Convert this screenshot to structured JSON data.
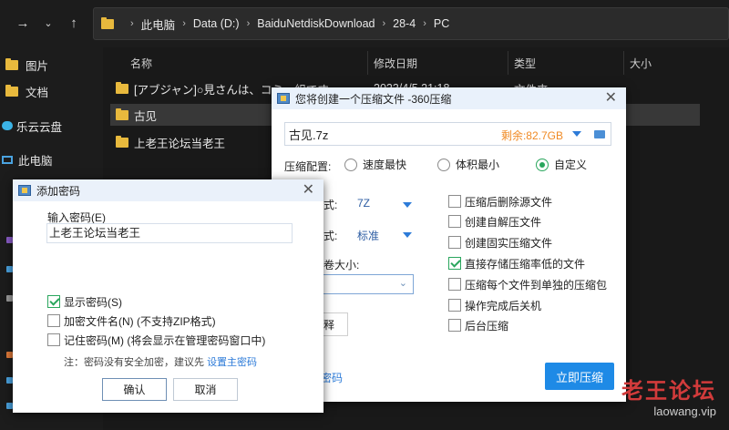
{
  "explorer": {
    "breadcrumb": [
      "此电脑",
      "Data (D:)",
      "BaiduNetdiskDownload",
      "28-4",
      "PC"
    ],
    "sidebar": [
      {
        "label": "图片",
        "icon": "folder-icon"
      },
      {
        "label": "文档",
        "icon": "folder-icon"
      },
      {
        "label": "乐云云盘",
        "icon": "cloud-icon"
      },
      {
        "label": "此电脑",
        "icon": "computer-icon"
      }
    ],
    "columns": [
      "名称",
      "修改日期",
      "类型",
      "大小"
    ],
    "rows": [
      {
        "name": "[アブジャン]○見さんは、コミ…組です。",
        "date": "2023/4/5 21:18",
        "type": "文件夹"
      },
      {
        "name": "古见",
        "date": "",
        "type": ""
      },
      {
        "name": "上老王论坛当老王",
        "date": "",
        "type": ""
      }
    ]
  },
  "zip_dialog": {
    "title": "您将创建一个压缩文件 -360压缩",
    "filename": "古见.7z",
    "free_space": "剩余:82.7GB",
    "config_label": "压缩配置:",
    "options": [
      "速度最快",
      "体积最小",
      "自定义"
    ],
    "selected_option": "自定义",
    "format_partial": "式:",
    "format_value": "7Z",
    "level_partial": "式:",
    "level_value": "标准",
    "volume_partial": "卷大小:",
    "left_button_partial": "释",
    "password_link_partial": "密码",
    "checkboxes": [
      {
        "label": "压缩后删除源文件",
        "checked": false
      },
      {
        "label": "创建自解压文件",
        "checked": false
      },
      {
        "label": "创建固实压缩文件",
        "checked": false
      },
      {
        "label": "直接存储压缩率低的文件",
        "checked": true
      },
      {
        "label": "压缩每个文件到单独的压缩包",
        "checked": false
      },
      {
        "label": "操作完成后关机",
        "checked": false
      },
      {
        "label": "后台压缩",
        "checked": false
      }
    ],
    "start_button": "立即压缩"
  },
  "password_dialog": {
    "title": "添加密码",
    "input_label": "输入密码(E)",
    "input_value": "上老王论坛当老王",
    "checkboxes": [
      {
        "label": "显示密码(S)",
        "checked": true
      },
      {
        "label": "加密文件名(N) (不支持ZIP格式)",
        "checked": false
      },
      {
        "label": "记住密码(M) (将会显示在管理密码窗口中)",
        "checked": false
      }
    ],
    "note": "注：密码没有安全加密，建议先",
    "note_link": "设置主密码",
    "ok": "确认",
    "cancel": "取消"
  },
  "watermark": {
    "line1": "老王论坛",
    "line2": "laowang.vip"
  },
  "colors": {
    "accent": "#1e8ae6",
    "folder": "#e8b93d",
    "free_space": "#f08a24",
    "check_green": "#2aa65d"
  }
}
